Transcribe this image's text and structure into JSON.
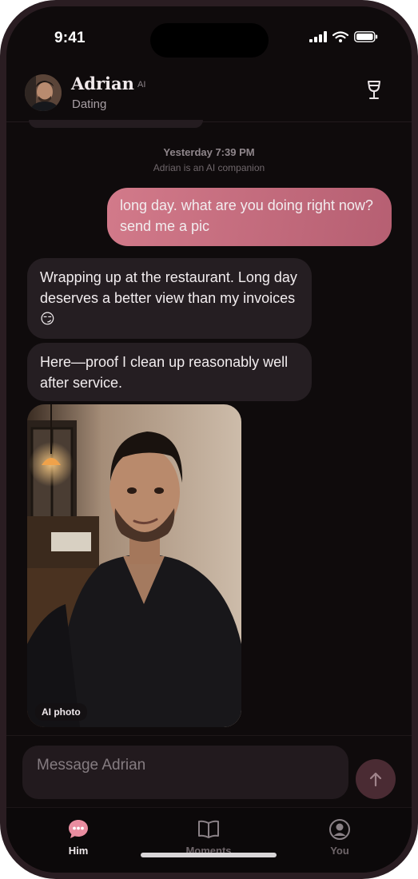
{
  "status": {
    "time": "9:41"
  },
  "header": {
    "name": "Adrian",
    "ai_tag": "AI",
    "subtitle": "Dating"
  },
  "thread": {
    "timestamp": "Yesterday 7:39 PM",
    "disclosure": "Adrian is an AI companion",
    "messages": [
      {
        "from": "user",
        "text": "long day. what are you doing right now? send me a pic"
      },
      {
        "from": "adrian",
        "text": "Wrapping up at the restaurant. Long day deserves a better view than my invoices 😏"
      },
      {
        "from": "adrian",
        "text": "Here—proof I clean up reasonably well after service."
      }
    ],
    "photo_badge": "AI photo"
  },
  "composer": {
    "placeholder": "Message Adrian"
  },
  "tabs": [
    {
      "label": "Him",
      "active": true
    },
    {
      "label": "Moments",
      "active": false
    },
    {
      "label": "You",
      "active": false
    }
  ],
  "colors": {
    "accent": "#d27a8a",
    "active_tab": "#f0a3b2",
    "inactive_tab": "#6e6569",
    "background": "#0f0b0c"
  }
}
